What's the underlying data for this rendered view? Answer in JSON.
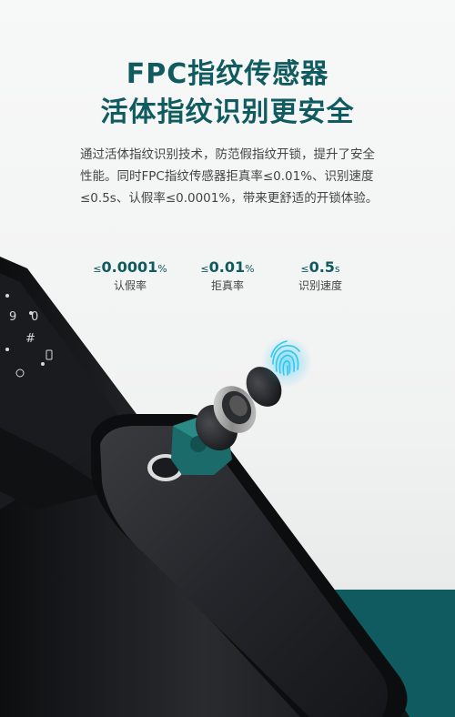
{
  "heading": {
    "line1": "FPC指纹传感器",
    "line2": "活体指纹识别更安全"
  },
  "description": "通过活体指纹识别技术，防范假指纹开锁，提升了安全性能。同时FPC指纹传感器拒真率≤0.01%、识别速度≤0.5s、认假率≤0.0001%，带来更舒适的开锁体验。",
  "stats": [
    {
      "symbol": "≤",
      "value": "0.0001",
      "unit": "%",
      "label": "认假率"
    },
    {
      "symbol": "≤",
      "value": "0.01",
      "unit": "%",
      "label": "拒真率"
    },
    {
      "symbol": "≤",
      "value": "0.5",
      "unit": "s",
      "label": "识别速度"
    }
  ],
  "keypad": {
    "row1": [
      "9",
      "0"
    ],
    "row2": [
      "#"
    ]
  },
  "colors": {
    "brand": "#0f5b5f",
    "lock_body": "#1c1d1f",
    "fingerprint_glow": "#2ec8f0"
  }
}
